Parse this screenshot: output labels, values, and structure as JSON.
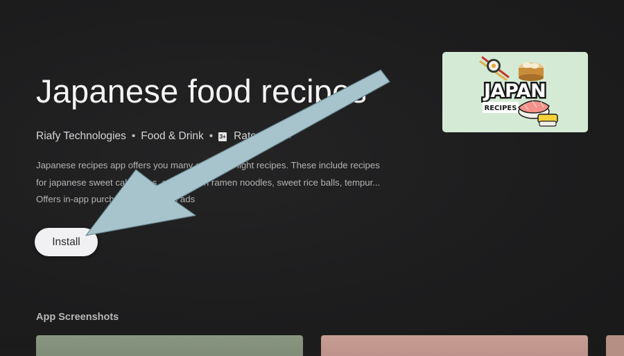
{
  "app": {
    "title": "Japanese food recipes",
    "developer": "Riafy Technologies",
    "category": "Food & Drink",
    "rating_badge": "3+",
    "rating_text": "Rated for 3+",
    "separator": "•",
    "description_lines": [
      "Japanese recipes app offers you many quick and light recipes. These include recipes",
      "for japanese sweet cake buns, sushi, udon ramen noodles, sweet rice balls, tempur...",
      "Offers in-app purchases · Contains ads"
    ]
  },
  "actions": {
    "install_label": "Install"
  },
  "feature_graphic": {
    "headline": "JAPAN",
    "subline": "RECIPES",
    "background_color": "#d5ead5"
  },
  "screenshots_section": {
    "title": "App Screenshots"
  },
  "annotation": {
    "arrow_color": "#a7c4cd",
    "icon": "arrow-pointer-icon"
  }
}
